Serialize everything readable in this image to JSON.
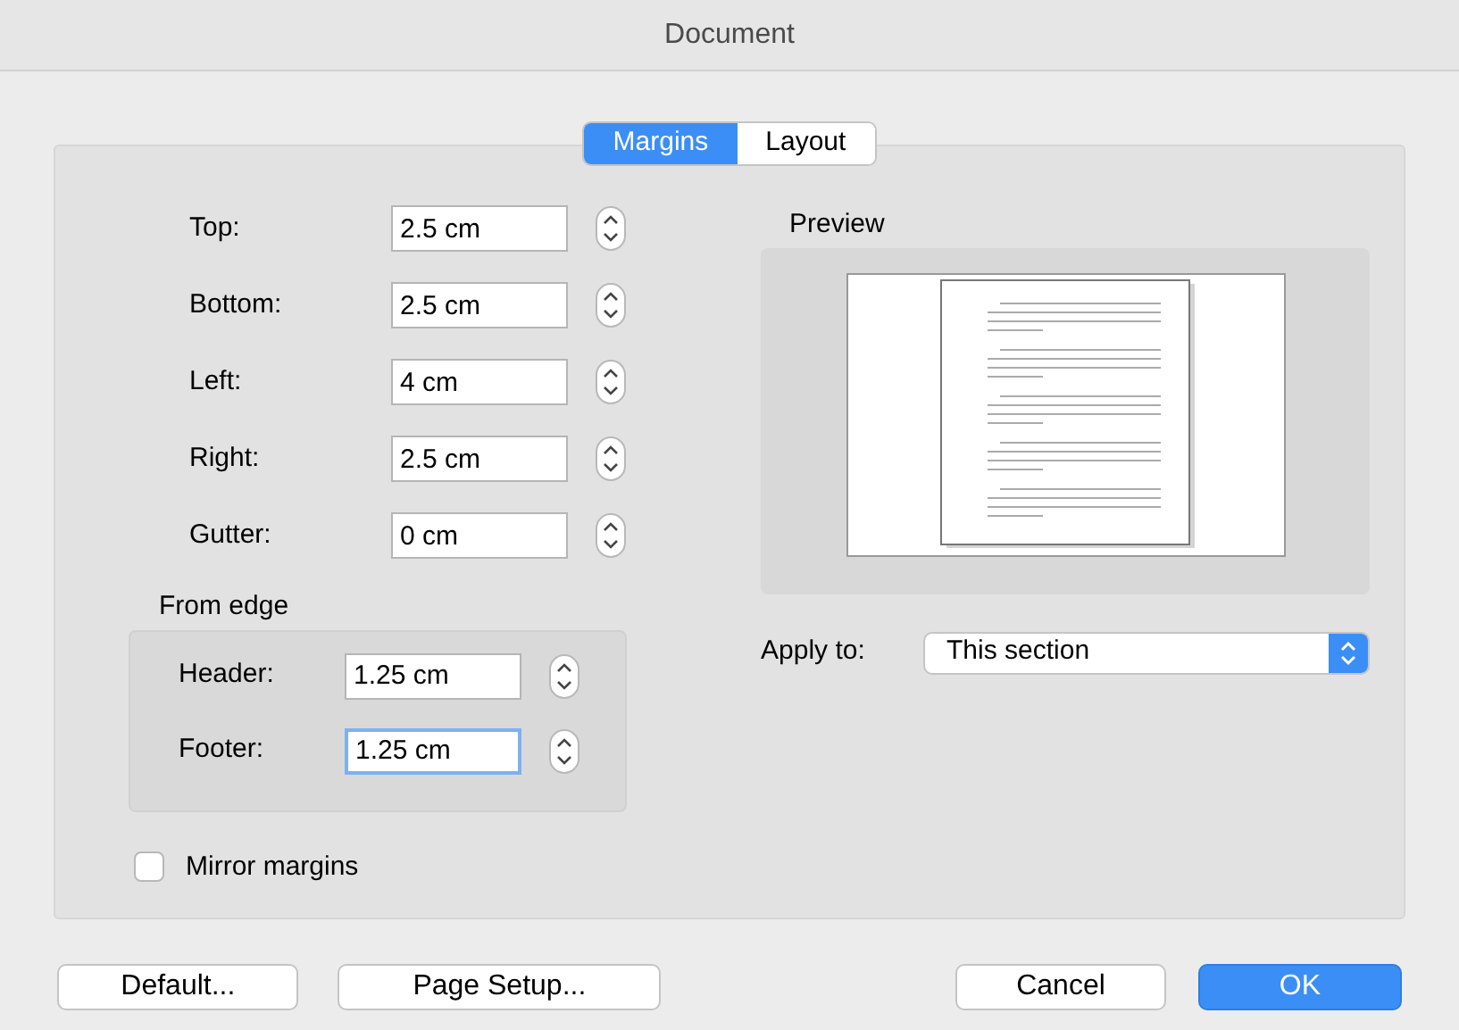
{
  "window": {
    "title": "Document"
  },
  "tabs": [
    {
      "label": "Margins",
      "selected": true
    },
    {
      "label": "Layout",
      "selected": false
    }
  ],
  "margins": [
    {
      "label": "Top:",
      "value": "2.5 cm",
      "focused": false
    },
    {
      "label": "Bottom:",
      "value": "2.5 cm",
      "focused": false
    },
    {
      "label": "Left:",
      "value": "4 cm",
      "focused": false
    },
    {
      "label": "Right:",
      "value": "2.5 cm",
      "focused": false
    },
    {
      "label": "Gutter:",
      "value": "0 cm",
      "focused": false
    }
  ],
  "from_edge": {
    "title": "From edge",
    "fields": [
      {
        "label": "Header:",
        "value": "1.25 cm",
        "focused": false
      },
      {
        "label": "Footer:",
        "value": "1.25 cm",
        "focused": true
      }
    ]
  },
  "mirror_margins": {
    "label": "Mirror margins",
    "checked": false
  },
  "preview": {
    "title": "Preview"
  },
  "apply_to": {
    "label": "Apply to:",
    "value": "This section"
  },
  "buttons": [
    {
      "label": "Default...",
      "kind": "normal"
    },
    {
      "label": "Page Setup...",
      "kind": "normal"
    },
    {
      "label": "Cancel",
      "kind": "normal"
    },
    {
      "label": "OK",
      "kind": "default"
    }
  ]
}
